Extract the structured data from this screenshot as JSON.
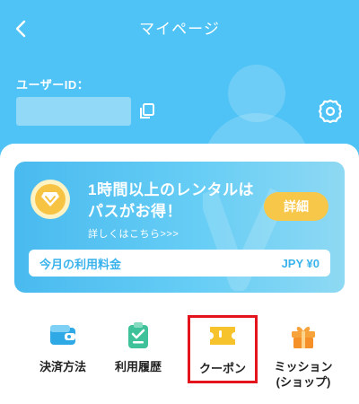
{
  "header": {
    "title": "マイページ",
    "user_id_label": "ユーザーID：",
    "user_id_value": ""
  },
  "promo": {
    "line1": "1時間以上のレンタルは",
    "line2": "パスがお得！",
    "details_link": "詳しくはこちら>>>",
    "details_button": "詳細",
    "fee_label": "今月の利用料金",
    "fee_value": "JPY ¥0"
  },
  "menu": {
    "items": [
      {
        "label": "決済方法"
      },
      {
        "label": "利用履歴"
      },
      {
        "label": "クーポン"
      },
      {
        "label": "ミッション\n(ショップ)"
      }
    ]
  },
  "colors": {
    "header_bg": "#4fc3f5",
    "accent": "#3ab3ec",
    "button_yellow": "#f7c74a",
    "highlight_red": "#e3141b"
  },
  "icons": [
    "back-arrow-icon",
    "copy-icon",
    "gear-icon",
    "diamond-icon",
    "wallet-icon",
    "clipboard-icon",
    "ticket-icon",
    "gift-icon"
  ]
}
